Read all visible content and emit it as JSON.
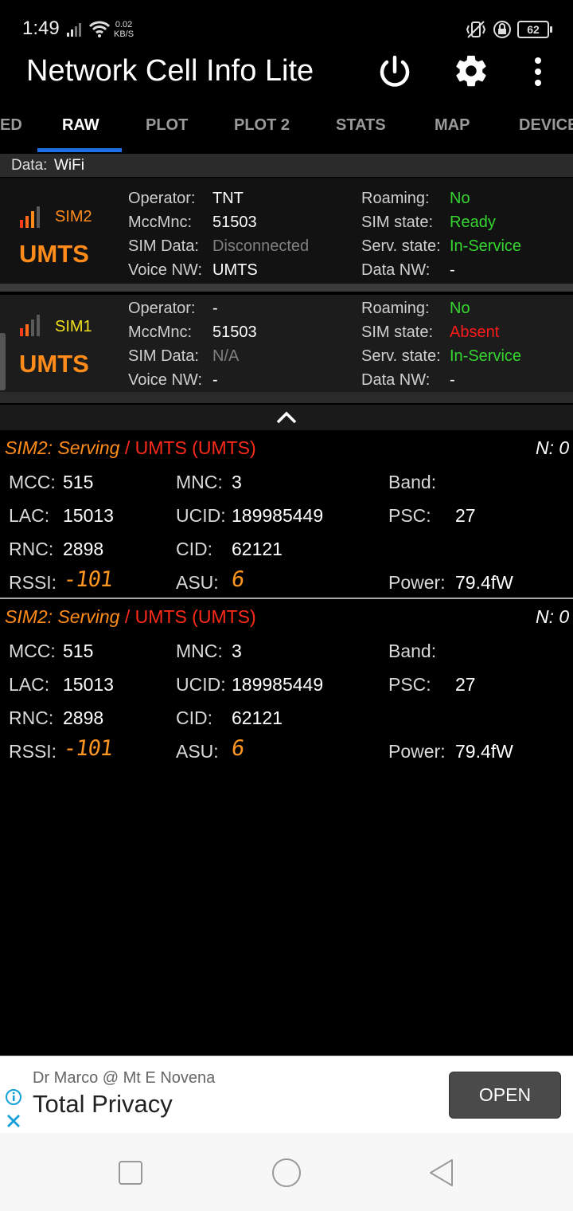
{
  "status_bar": {
    "time": "1:49",
    "net_speed_value": "0.02",
    "net_speed_unit": "KB/S",
    "battery": "62",
    "icons": [
      "signal-icon",
      "wifi-icon",
      "vibrate-icon",
      "lock-rotation-icon",
      "battery-icon"
    ]
  },
  "app_bar": {
    "title": "Network Cell Info Lite",
    "icons": [
      "power-icon",
      "settings-icon",
      "more-vert-icon"
    ]
  },
  "tabs": [
    {
      "label": "ED",
      "active": false
    },
    {
      "label": "RAW",
      "active": true
    },
    {
      "label": "PLOT",
      "active": false
    },
    {
      "label": "PLOT 2",
      "active": false
    },
    {
      "label": "STATS",
      "active": false
    },
    {
      "label": "MAP",
      "active": false
    },
    {
      "label": "DEVICE",
      "active": false
    }
  ],
  "data_line": {
    "label": "Data:",
    "value": "WiFi"
  },
  "sims": [
    {
      "sim_label": "SIM2",
      "network_type": "UMTS",
      "labels": {
        "operator": "Operator:",
        "mccmnc": "MccMnc:",
        "sim_data": "SIM Data:",
        "voice_nw": "Voice NW:",
        "roaming": "Roaming:",
        "sim_state": "SIM state:",
        "serv_state": "Serv. state:",
        "data_nw": "Data NW:"
      },
      "values": {
        "operator": "TNT",
        "mccmnc": "51503",
        "sim_data": "Disconnected",
        "voice_nw": "UMTS",
        "roaming": "No",
        "sim_state": "Ready",
        "serv_state": "In-Service",
        "data_nw": "-"
      }
    },
    {
      "sim_label": "SIM1",
      "network_type": "UMTS",
      "labels": {
        "operator": "Operator:",
        "mccmnc": "MccMnc:",
        "sim_data": "SIM Data:",
        "voice_nw": "Voice NW:",
        "roaming": "Roaming:",
        "sim_state": "SIM state:",
        "serv_state": "Serv. state:",
        "data_nw": "Data NW:"
      },
      "values": {
        "operator": "-",
        "mccmnc": "51503",
        "sim_data": "N/A",
        "voice_nw": "-",
        "roaming": "No",
        "sim_state": "Absent",
        "serv_state": "In-Service",
        "data_nw": "-"
      }
    }
  ],
  "cells": [
    {
      "head_sim": "SIM2: Serving",
      "head_sep": " / ",
      "head_type": "UMTS (UMTS)",
      "neighbors": "N: 0",
      "labels": {
        "mcc": "MCC:",
        "mnc": "MNC:",
        "band": "Band:",
        "lac": "LAC:",
        "ucid": "UCID:",
        "psc": "PSC:",
        "rnc": "RNC:",
        "cid": "CID:",
        "rssi": "RSSI:",
        "asu": "ASU:",
        "power": "Power:"
      },
      "values": {
        "mcc": "515",
        "mnc": "3",
        "band": "",
        "lac": "15013",
        "ucid": "189985449",
        "psc": "27",
        "rnc": "2898",
        "cid": "62121",
        "rssi": "-101",
        "asu": "6",
        "power": "79.4fW"
      }
    },
    {
      "head_sim": "SIM2: Serving",
      "head_sep": " / ",
      "head_type": "UMTS (UMTS)",
      "neighbors": "N: 0",
      "labels": {
        "mcc": "MCC:",
        "mnc": "MNC:",
        "band": "Band:",
        "lac": "LAC:",
        "ucid": "UCID:",
        "psc": "PSC:",
        "rnc": "RNC:",
        "cid": "CID:",
        "rssi": "RSSI:",
        "asu": "ASU:",
        "power": "Power:"
      },
      "values": {
        "mcc": "515",
        "mnc": "3",
        "band": "",
        "lac": "15013",
        "ucid": "189985449",
        "psc": "27",
        "rnc": "2898",
        "cid": "62121",
        "rssi": "-101",
        "asu": "6",
        "power": "79.4fW"
      }
    }
  ],
  "ad": {
    "advertiser": "Dr Marco @ Mt E Novena",
    "headline": "Total Privacy",
    "cta": "OPEN"
  },
  "nav_bar": {
    "icons": [
      "recents-icon",
      "home-icon",
      "back-icon"
    ]
  },
  "colors": {
    "accent_blue": "#1e6fe6",
    "orange": "#ff8c1a",
    "green": "#34d62f",
    "red": "#ff1a1a"
  }
}
